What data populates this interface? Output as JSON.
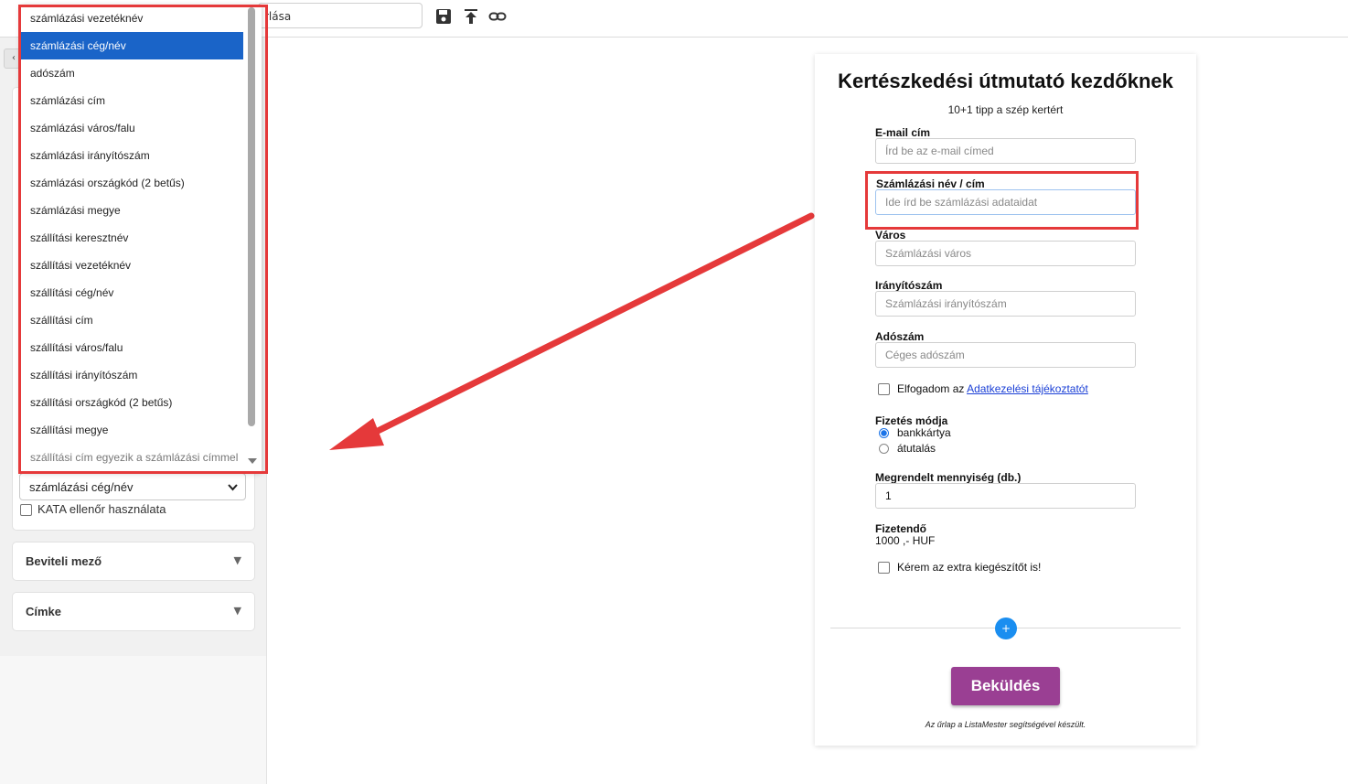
{
  "toolbar": {
    "name_field_value": "űrlap ...rlása",
    "name_field_visible": "rlása",
    "icons": [
      "save-icon",
      "upload-icon",
      "link-icon"
    ]
  },
  "sidebar": {
    "collapse_glyph": "‹",
    "select_value": "számlázási cég/név",
    "kata_label": "KATA ellenőr használata",
    "accordions": [
      {
        "label": "Beviteli mező",
        "caret": "▼"
      },
      {
        "label": "Címke",
        "caret": "▼"
      }
    ]
  },
  "dropdown": {
    "items": [
      "számlázási vezetéknév",
      "számlázási cég/név",
      "adószám",
      "számlázási cím",
      "számlázási város/falu",
      "számlázási irányítószám",
      "számlázási országkód (2 betűs)",
      "számlázási megye",
      "szállítási keresztnév",
      "szállítási vezetéknév",
      "szállítási cég/név",
      "szállítási cím",
      "szállítási város/falu",
      "szállítási irányítószám",
      "szállítási országkód (2 betűs)",
      "szállítási megye",
      "szállítási cím egyezik a számlázási címmel"
    ],
    "selected_index": 1
  },
  "form": {
    "title": "Kertészkedési útmutató kezdőknek",
    "subtitle": "10+1 tipp a szép kertért",
    "email_label": "E-mail cím",
    "email_placeholder": "Írd be az e-mail címed",
    "billing_label": "Számlázási név / cím",
    "billing_placeholder": "Ide írd be számlázási adataidat",
    "city_label": "Város",
    "city_placeholder": "Számlázási város",
    "zip_label": "Irányítószám",
    "zip_placeholder": "Számlázási irányítószám",
    "tax_label": "Adószám",
    "tax_placeholder": "Céges adószám",
    "consent_prefix": "Elfogadom az",
    "consent_link": "Adatkezelési tájékoztatót",
    "payment_label": "Fizetés módja",
    "payment_options": [
      "bankkártya",
      "átutalás"
    ],
    "payment_selected": 0,
    "quantity_label": "Megrendelt mennyiség (db.)",
    "quantity_value": "1",
    "total_label": "Fizetendő",
    "total_value": "1000 ,- HUF",
    "extra_label": "Kérem az extra kiegészítőt is!",
    "add_glyph": "+",
    "submit_label": "Beküldés",
    "footer_note": "Az űrlap a ListaMester segítségével készült."
  },
  "annotation_color": "#e5393a"
}
